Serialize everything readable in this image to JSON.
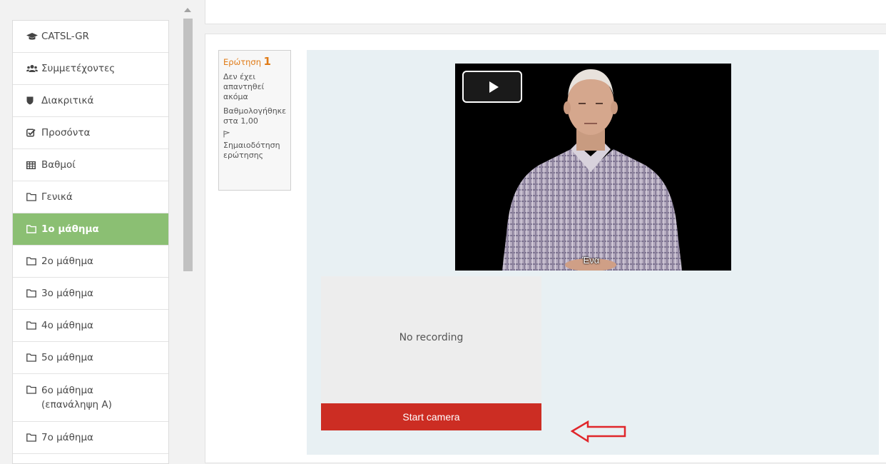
{
  "sidebar": {
    "items": [
      {
        "label": "CATSL-GR",
        "icon": "graduation-cap-icon"
      },
      {
        "label": "Συμμετέχοντες",
        "icon": "users-icon"
      },
      {
        "label": "Διακριτικά",
        "icon": "shield-icon"
      },
      {
        "label": "Προσόντα",
        "icon": "checkbox-icon"
      },
      {
        "label": "Βαθμοί",
        "icon": "table-icon"
      },
      {
        "label": "Γενικά",
        "icon": "folder-icon"
      },
      {
        "label": "1ο μάθημα",
        "icon": "folder-icon",
        "active": true
      },
      {
        "label": "2ο μάθημα",
        "icon": "folder-icon"
      },
      {
        "label": "3ο μάθημα",
        "icon": "folder-icon"
      },
      {
        "label": "4ο μάθημα",
        "icon": "folder-icon"
      },
      {
        "label": "5ο μάθημα",
        "icon": "folder-icon"
      },
      {
        "label": "6ο μάθημα",
        "label2": "(επανάληψη Α)",
        "icon": "folder-icon"
      },
      {
        "label": "7ο μάθημα",
        "icon": "folder-icon"
      }
    ]
  },
  "question": {
    "label": "Ερώτηση",
    "number": "1",
    "status": "Δεν έχει απαντηθεί ακόμα",
    "grade": "Βαθμολογήθηκε στα 1,00",
    "flag_label": "Σημαιοδότηση ερώτησης"
  },
  "video": {
    "subtitle": "Ένα"
  },
  "recorder": {
    "message": "No recording",
    "start_label": "Start camera"
  },
  "colors": {
    "active_item": "#8bbf73",
    "question_accent": "#e07b17",
    "start_button": "#cc2d23",
    "annotation_arrow": "#e0262b"
  }
}
